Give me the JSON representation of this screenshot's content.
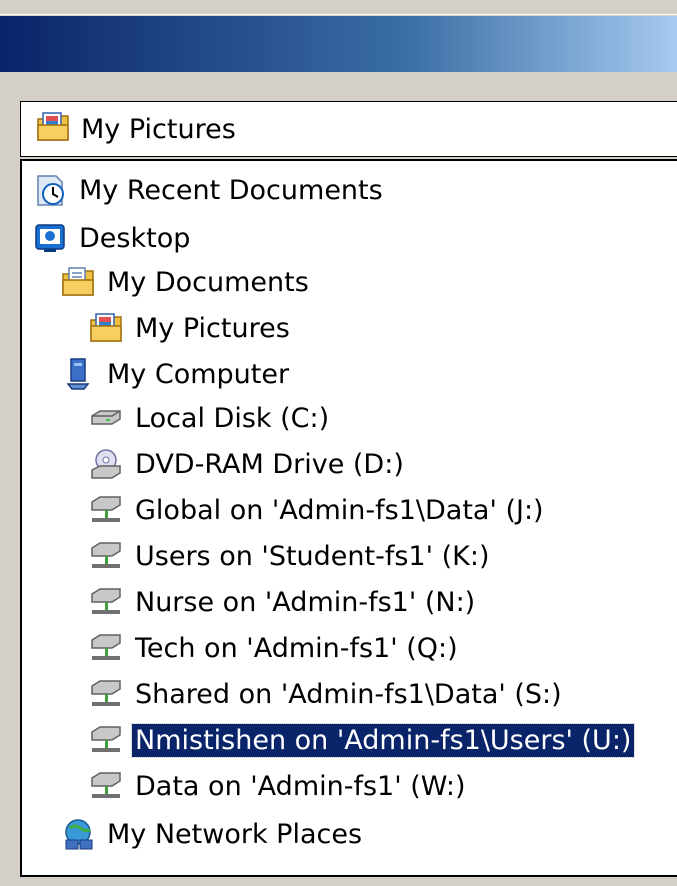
{
  "location_combo": {
    "value": "My Pictures",
    "icon": "my-pictures-icon"
  },
  "tree": {
    "items": [
      {
        "label": "My Recent Documents",
        "icon": "recent-documents-icon"
      },
      {
        "label": "Desktop",
        "icon": "desktop-icon"
      },
      {
        "label": "My Documents",
        "icon": "my-documents-icon"
      },
      {
        "label": "My Pictures",
        "icon": "my-pictures-icon"
      },
      {
        "label": "My Computer",
        "icon": "my-computer-icon"
      },
      {
        "label": "Local Disk (C:)",
        "icon": "local-disk-icon"
      },
      {
        "label": "DVD-RAM Drive (D:)",
        "icon": "dvd-drive-icon"
      },
      {
        "label": "Global on 'Admin-fs1\\Data' (J:)",
        "icon": "network-drive-icon"
      },
      {
        "label": "Users on 'Student-fs1' (K:)",
        "icon": "network-drive-icon"
      },
      {
        "label": "Nurse on 'Admin-fs1' (N:)",
        "icon": "network-drive-icon"
      },
      {
        "label": "Tech on 'Admin-fs1' (Q:)",
        "icon": "network-drive-icon"
      },
      {
        "label": "Shared on 'Admin-fs1\\Data' (S:)",
        "icon": "network-drive-icon"
      },
      {
        "label": "Nmistishen on 'Admin-fs1\\Users' (U:)",
        "icon": "network-drive-icon",
        "selected": true
      },
      {
        "label": "Data on 'Admin-fs1' (W:)",
        "icon": "network-drive-icon"
      },
      {
        "label": "My Network Places",
        "icon": "network-places-icon"
      }
    ]
  },
  "colors": {
    "selection": "#0a246a",
    "title_bar": "#0a246a",
    "face": "#d4d0c8"
  }
}
